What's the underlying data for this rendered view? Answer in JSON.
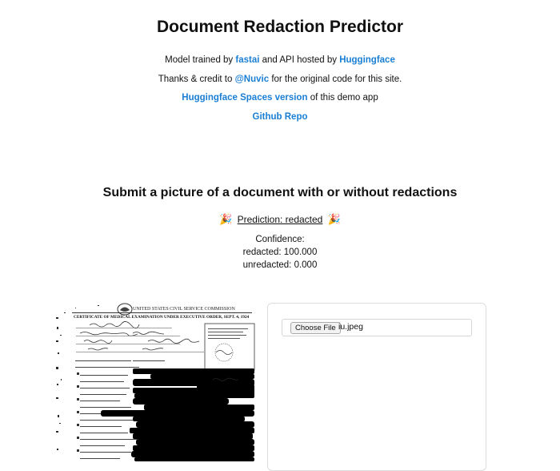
{
  "header": {
    "title": "Document Redaction Predictor",
    "line1": {
      "prefix": "Model trained by",
      "link1": "fastai",
      "middle": "and API hosted by",
      "link2": "Huggingface"
    },
    "line2": {
      "prefix": "Thanks & credit to",
      "link": "@Nuvic",
      "suffix": "for the original code for this site."
    },
    "line3": {
      "link": "Huggingface Spaces version",
      "suffix": "of this demo app"
    },
    "line4": {
      "link": "Github Repo"
    }
  },
  "main": {
    "subtitle": "Submit a picture of a document with or without redactions",
    "prediction": {
      "text": "Prediction: redacted",
      "emoji": "🎉"
    },
    "confidence": {
      "label": "Confidence:",
      "redacted": "redacted: 100.000",
      "unredacted": "unredacted: 0.000"
    }
  },
  "document_preview": {
    "header": "UNITED STATES CIVIL SERVICE COMMISSION",
    "form_title": "CERTIFICATE OF MEDICAL EXAMINATION UNDER EXECUTIVE ORDER, SEPT. 4, 1924"
  },
  "upload": {
    "button_label": "Choose File",
    "file_name": "iu.jpeg"
  },
  "colors": {
    "link": "#1a7fd4",
    "text": "#111111",
    "border": "#dcdcdc"
  }
}
